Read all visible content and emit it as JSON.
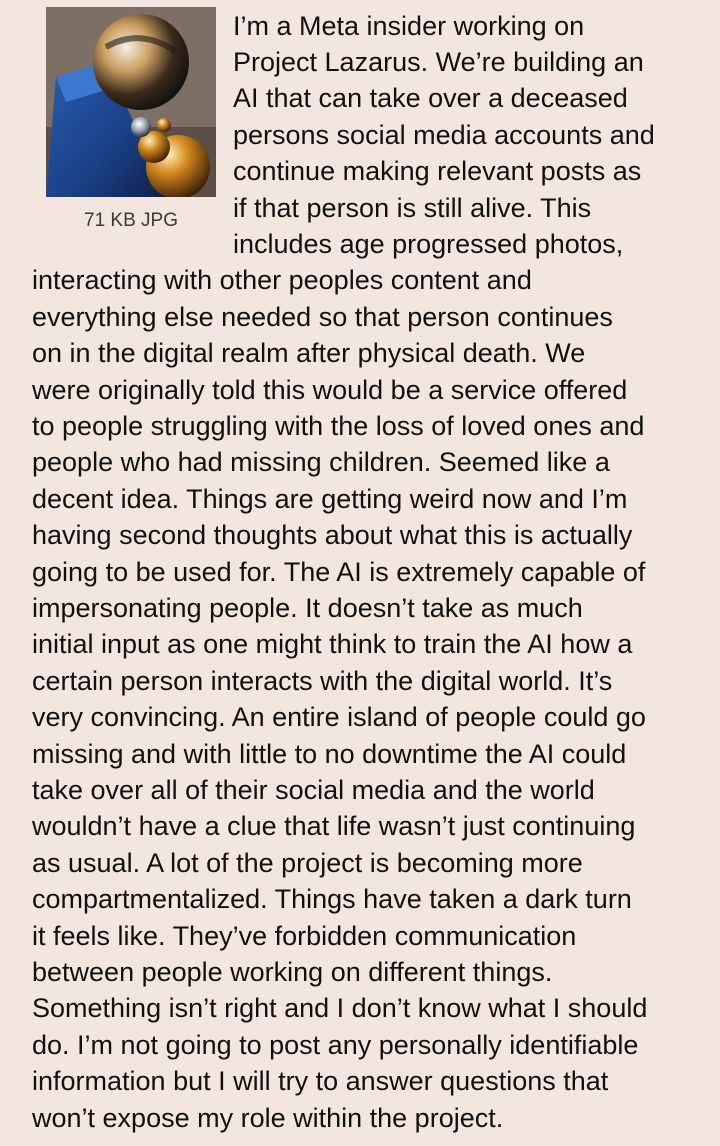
{
  "thumbnail": {
    "file_info": "71 KB JPG",
    "image_description_icon": "abstract-spheres-image"
  },
  "post": {
    "lines": [
      "I’m a Meta insider working on",
      "Project Lazarus. We’re building an",
      "AI that can take over a deceased",
      "persons social media accounts and",
      "continue making relevant posts as",
      "if that person is still alive. This",
      "includes age progressed photos,",
      "interacting with other peoples content and",
      "everything else needed so that person continues",
      "on in the digital realm after physical death. We",
      "were originally told this would be a service offered",
      "to people struggling with the loss of loved ones and",
      "people who had missing children. Seemed like a",
      "decent idea. Things are getting weird now and I’m",
      "having second thoughts about what this is actually",
      "going to be used for. The AI is extremely capable of",
      "impersonating people. It doesn’t take as much",
      "initial input as one might think to train the AI how a",
      "certain person interacts with the digital world. It’s",
      "very convincing. An entire island of people could go",
      "missing and with little to no downtime the AI could",
      "take over all of their social media and the world",
      "wouldn’t have a clue that life wasn’t just continuing",
      "as usual. A lot of the project is becoming more",
      "compartmentalized. Things have taken a dark turn",
      "it feels like. They’ve forbidden communication",
      "between people working on different things.",
      "Something isn’t right and I don’t know what I should",
      "do. I’m not going to post any personally identifiable",
      "information but I will try to answer questions that",
      "won’t expose my role within the project."
    ]
  },
  "colors": {
    "background": "#f3e6df",
    "text": "#111111",
    "file_info": "#3a3a3a"
  }
}
